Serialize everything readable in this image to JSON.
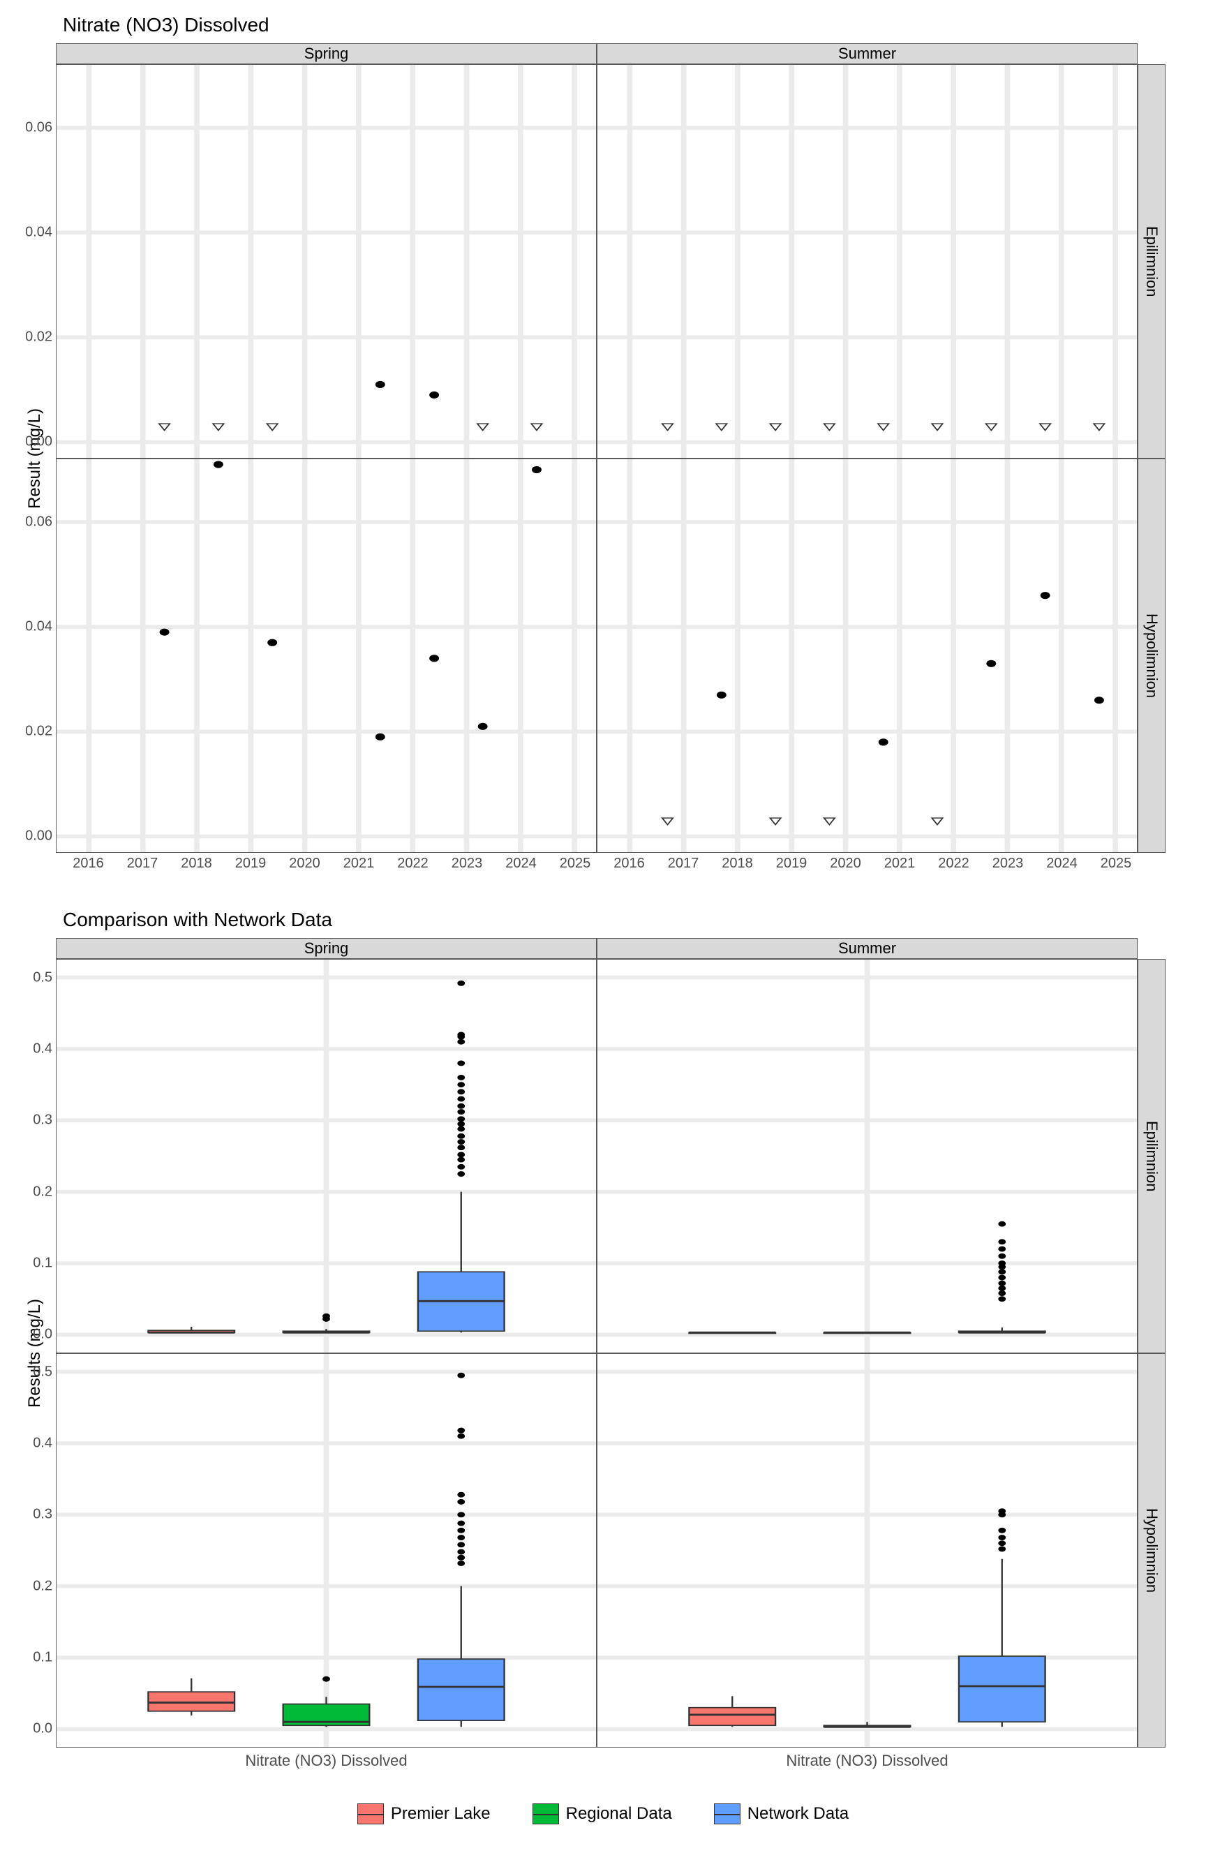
{
  "chart_data": [
    {
      "title": "Nitrate (NO3) Dissolved",
      "type": "scatter",
      "ylabel": "Result (mg/L)",
      "xlabel": "",
      "facets_col": [
        "Spring",
        "Summer"
      ],
      "facets_row": [
        "Epilimnion",
        "Hypolimnion"
      ],
      "x_ticks": [
        2016,
        2017,
        2018,
        2019,
        2020,
        2021,
        2022,
        2023,
        2024,
        2025
      ],
      "y_ticks": [
        0.0,
        0.02,
        0.04,
        0.06
      ],
      "xlim": [
        2015.4,
        2025.4
      ],
      "ylim": [
        -0.003,
        0.072
      ],
      "panels": {
        "Spring|Epilimnion": {
          "solid": [
            [
              2021.4,
              0.011
            ],
            [
              2022.4,
              0.009
            ]
          ],
          "open": [
            [
              2017.4,
              0.003
            ],
            [
              2018.4,
              0.003
            ],
            [
              2019.4,
              0.003
            ],
            [
              2023.3,
              0.003
            ],
            [
              2024.3,
              0.003
            ]
          ]
        },
        "Summer|Epilimnion": {
          "solid": [],
          "open": [
            [
              2016.7,
              0.003
            ],
            [
              2017.7,
              0.003
            ],
            [
              2018.7,
              0.003
            ],
            [
              2019.7,
              0.003
            ],
            [
              2020.7,
              0.003
            ],
            [
              2021.7,
              0.003
            ],
            [
              2022.7,
              0.003
            ],
            [
              2023.7,
              0.003
            ],
            [
              2024.7,
              0.003
            ]
          ]
        },
        "Spring|Hypolimnion": {
          "solid": [
            [
              2017.4,
              0.039
            ],
            [
              2018.4,
              0.071
            ],
            [
              2019.4,
              0.037
            ],
            [
              2021.4,
              0.019
            ],
            [
              2022.4,
              0.034
            ],
            [
              2023.3,
              0.021
            ],
            [
              2024.3,
              0.07
            ]
          ],
          "open": []
        },
        "Summer|Hypolimnion": {
          "solid": [
            [
              2017.7,
              0.027
            ],
            [
              2020.7,
              0.018
            ],
            [
              2022.7,
              0.033
            ],
            [
              2023.7,
              0.046
            ],
            [
              2024.7,
              0.026
            ]
          ],
          "open": [
            [
              2016.7,
              0.003
            ],
            [
              2018.7,
              0.003
            ],
            [
              2019.7,
              0.003
            ],
            [
              2021.7,
              0.003
            ]
          ]
        }
      }
    },
    {
      "title": "Comparison with Network Data",
      "type": "boxplot",
      "ylabel": "Results (mg/L)",
      "xlabel": "Nitrate (NO3) Dissolved",
      "facets_col": [
        "Spring",
        "Summer"
      ],
      "facets_row": [
        "Epilimnion",
        "Hypolimnion"
      ],
      "y_ticks": [
        0.0,
        0.1,
        0.2,
        0.3,
        0.4,
        0.5
      ],
      "ylim": [
        -0.025,
        0.525
      ],
      "colors": {
        "Premier Lake": "#F8766D",
        "Regional Data": "#00BA38",
        "Network Data": "#619CFF"
      },
      "legend": [
        "Premier Lake",
        "Regional Data",
        "Network Data"
      ],
      "panels": {
        "Spring|Epilimnion": {
          "Premier Lake": {
            "min": 0.003,
            "q1": 0.003,
            "med": 0.003,
            "q3": 0.006,
            "max": 0.011,
            "out": []
          },
          "Regional Data": {
            "min": 0.003,
            "q1": 0.003,
            "med": 0.003,
            "q3": 0.005,
            "max": 0.008,
            "out": [
              0.022,
              0.026
            ]
          },
          "Network Data": {
            "min": 0.003,
            "q1": 0.005,
            "med": 0.047,
            "q3": 0.088,
            "max": 0.2,
            "out": [
              0.225,
              0.235,
              0.245,
              0.252,
              0.262,
              0.27,
              0.278,
              0.288,
              0.295,
              0.302,
              0.312,
              0.32,
              0.33,
              0.34,
              0.35,
              0.36,
              0.38,
              0.41,
              0.417,
              0.42,
              0.492
            ]
          }
        },
        "Summer|Epilimnion": {
          "Premier Lake": {
            "min": 0.003,
            "q1": 0.003,
            "med": 0.003,
            "q3": 0.003,
            "max": 0.003,
            "out": []
          },
          "Regional Data": {
            "min": 0.003,
            "q1": 0.003,
            "med": 0.003,
            "q3": 0.003,
            "max": 0.003,
            "out": []
          },
          "Network Data": {
            "min": 0.003,
            "q1": 0.003,
            "med": 0.003,
            "q3": 0.005,
            "max": 0.01,
            "out": [
              0.05,
              0.058,
              0.065,
              0.072,
              0.08,
              0.088,
              0.095,
              0.1,
              0.11,
              0.12,
              0.13,
              0.155
            ]
          }
        },
        "Spring|Hypolimnion": {
          "Premier Lake": {
            "min": 0.019,
            "q1": 0.025,
            "med": 0.037,
            "q3": 0.052,
            "max": 0.071,
            "out": []
          },
          "Regional Data": {
            "min": 0.003,
            "q1": 0.005,
            "med": 0.01,
            "q3": 0.035,
            "max": 0.045,
            "out": [
              0.07
            ]
          },
          "Network Data": {
            "min": 0.003,
            "q1": 0.012,
            "med": 0.059,
            "q3": 0.098,
            "max": 0.2,
            "out": [
              0.232,
              0.24,
              0.248,
              0.258,
              0.268,
              0.278,
              0.288,
              0.3,
              0.318,
              0.328,
              0.41,
              0.418,
              0.495
            ]
          }
        },
        "Summer|Hypolimnion": {
          "Premier Lake": {
            "min": 0.003,
            "q1": 0.005,
            "med": 0.02,
            "q3": 0.03,
            "max": 0.046,
            "out": []
          },
          "Regional Data": {
            "min": 0.003,
            "q1": 0.003,
            "med": 0.003,
            "q3": 0.005,
            "max": 0.01,
            "out": []
          },
          "Network Data": {
            "min": 0.003,
            "q1": 0.01,
            "med": 0.06,
            "q3": 0.102,
            "max": 0.238,
            "out": [
              0.252,
              0.26,
              0.268,
              0.278,
              0.3,
              0.305
            ]
          }
        }
      }
    }
  ]
}
